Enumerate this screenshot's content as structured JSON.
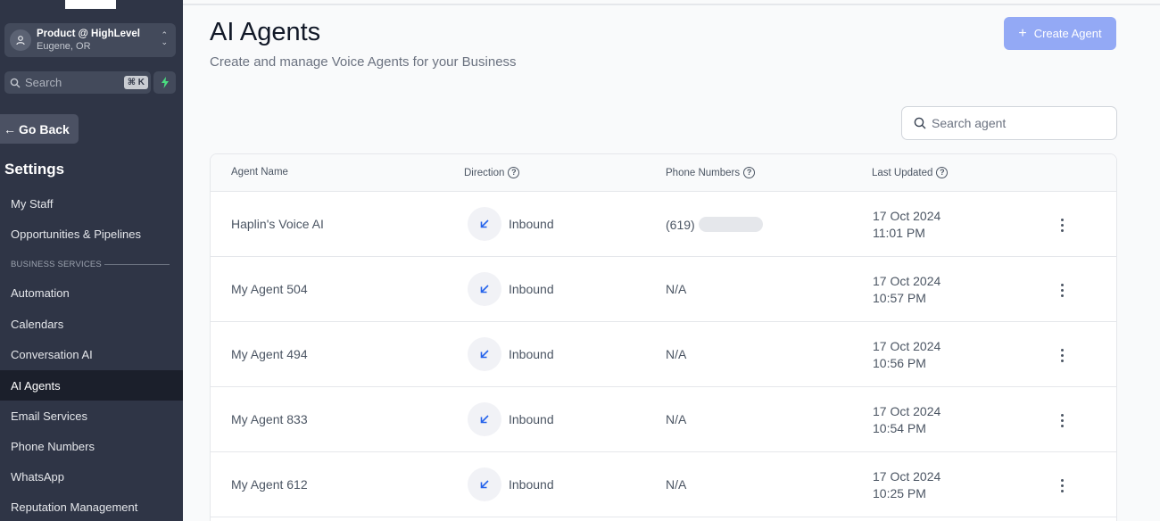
{
  "account": {
    "name": "Product @ HighLevel",
    "location": "Eugene, OR"
  },
  "sidebar": {
    "search_label": "Search",
    "search_shortcut": "⌘ K",
    "go_back": "Go Back",
    "settings_title": "Settings",
    "section_label": "BUSINESS SERVICES",
    "items": [
      {
        "label": "My Staff"
      },
      {
        "label": "Opportunities & Pipelines"
      },
      {
        "label": "Automation"
      },
      {
        "label": "Calendars"
      },
      {
        "label": "Conversation AI"
      },
      {
        "label": "AI Agents",
        "active": true
      },
      {
        "label": "Email Services"
      },
      {
        "label": "Phone Numbers"
      },
      {
        "label": "WhatsApp"
      },
      {
        "label": "Reputation Management"
      }
    ]
  },
  "main": {
    "title": "AI Agents",
    "subtitle": "Create and manage Voice Agents for your Business",
    "create_button": "Create Agent",
    "search_placeholder": "Search agent",
    "columns": [
      "Agent Name",
      "Direction",
      "Phone Numbers",
      "Last Updated"
    ],
    "rows": [
      {
        "name": "Haplin's Voice AI",
        "direction": "Inbound",
        "phone": "(619)",
        "phone_redacted": true,
        "date": "17 Oct 2024",
        "time": "11:01 PM"
      },
      {
        "name": "My Agent 504",
        "direction": "Inbound",
        "phone": "N/A",
        "phone_redacted": false,
        "date": "17 Oct 2024",
        "time": "10:57 PM"
      },
      {
        "name": "My Agent 494",
        "direction": "Inbound",
        "phone": "N/A",
        "phone_redacted": false,
        "date": "17 Oct 2024",
        "time": "10:56 PM"
      },
      {
        "name": "My Agent 833",
        "direction": "Inbound",
        "phone": "N/A",
        "phone_redacted": false,
        "date": "17 Oct 2024",
        "time": "10:54 PM"
      },
      {
        "name": "My Agent 612",
        "direction": "Inbound",
        "phone": "N/A",
        "phone_redacted": false,
        "date": "17 Oct 2024",
        "time": "10:25 PM"
      }
    ]
  },
  "colors": {
    "sidebar_bg": "#2f3546",
    "active_item_bg": "#1b1f2b",
    "accent_button": "#93a9f5",
    "inbound_arrow": "#2563eb",
    "bolt": "#4ade80"
  }
}
